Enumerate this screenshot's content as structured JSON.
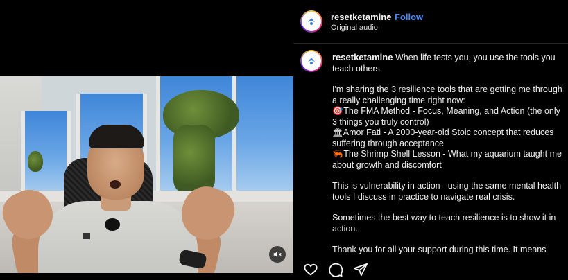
{
  "header": {
    "username": "resetketamine",
    "separator": "•",
    "follow_label": "Follow",
    "audio_label": "Original audio"
  },
  "post": {
    "username": "resetketamine",
    "intro": "When life tests you, you use the tools you teach others.",
    "para1": "I'm sharing the 3 resilience tools that are getting me through a really challenging time right now:",
    "tool1_icon": "🎯",
    "tool1": "The FMA Method - Focus, Meaning, and Action (the only 3 things you truly control)",
    "tool2_icon": "🏛",
    "tool2": "Amor Fati - A 2000-year-old Stoic concept that reduces suffering through acceptance",
    "tool3_icon": "🦐",
    "tool3": "The Shrimp Shell Lesson - What my aquarium taught me about growth and discomfort",
    "para2": "This is vulnerability in action - using the same mental health tools I discuss in practice to navigate real crisis.",
    "para3": "Sometimes the best way to teach resilience is to show it in action.",
    "para4": "Thank you for all your support during this time. It means"
  },
  "actions": {
    "like_icon": "heart-icon",
    "comment_icon": "comment-icon",
    "share_icon": "share-icon"
  },
  "video": {
    "mute_icon": "muted-speaker-icon"
  },
  "colors": {
    "follow": "#4a8cf7",
    "background": "#000000",
    "text": "#f5f5f5"
  }
}
